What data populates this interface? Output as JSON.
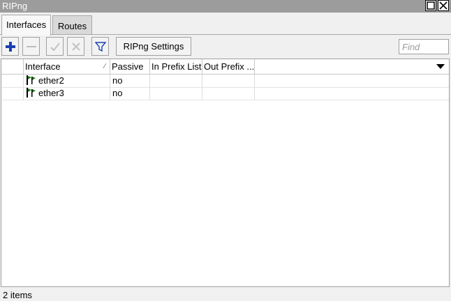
{
  "window": {
    "title": "RIPng"
  },
  "tabs": [
    {
      "label": "Interfaces",
      "active": true
    },
    {
      "label": "Routes",
      "active": false
    }
  ],
  "toolbar": {
    "add_icon": "plus-icon",
    "remove_icon": "minus-icon",
    "enable_icon": "check-icon",
    "disable_icon": "x-icon",
    "filter_icon": "funnel-icon",
    "settings_label": "RIPng Settings",
    "find_placeholder": "Find"
  },
  "table": {
    "columns": [
      "",
      "Interface",
      "Passive",
      "In Prefix List",
      "Out Prefix ..."
    ],
    "rows": [
      {
        "interface": "ether2",
        "passive": "no",
        "in_prefix_list": "",
        "out_prefix_list": ""
      },
      {
        "interface": "ether3",
        "passive": "no",
        "in_prefix_list": "",
        "out_prefix_list": ""
      }
    ]
  },
  "status": {
    "items_text": "2 items"
  },
  "colors": {
    "titlebar": "#9c9c9c",
    "add_icon": "#1a3fb0",
    "filter_icon": "#1a3fb0",
    "interface_icon": "#1a7a1a"
  }
}
